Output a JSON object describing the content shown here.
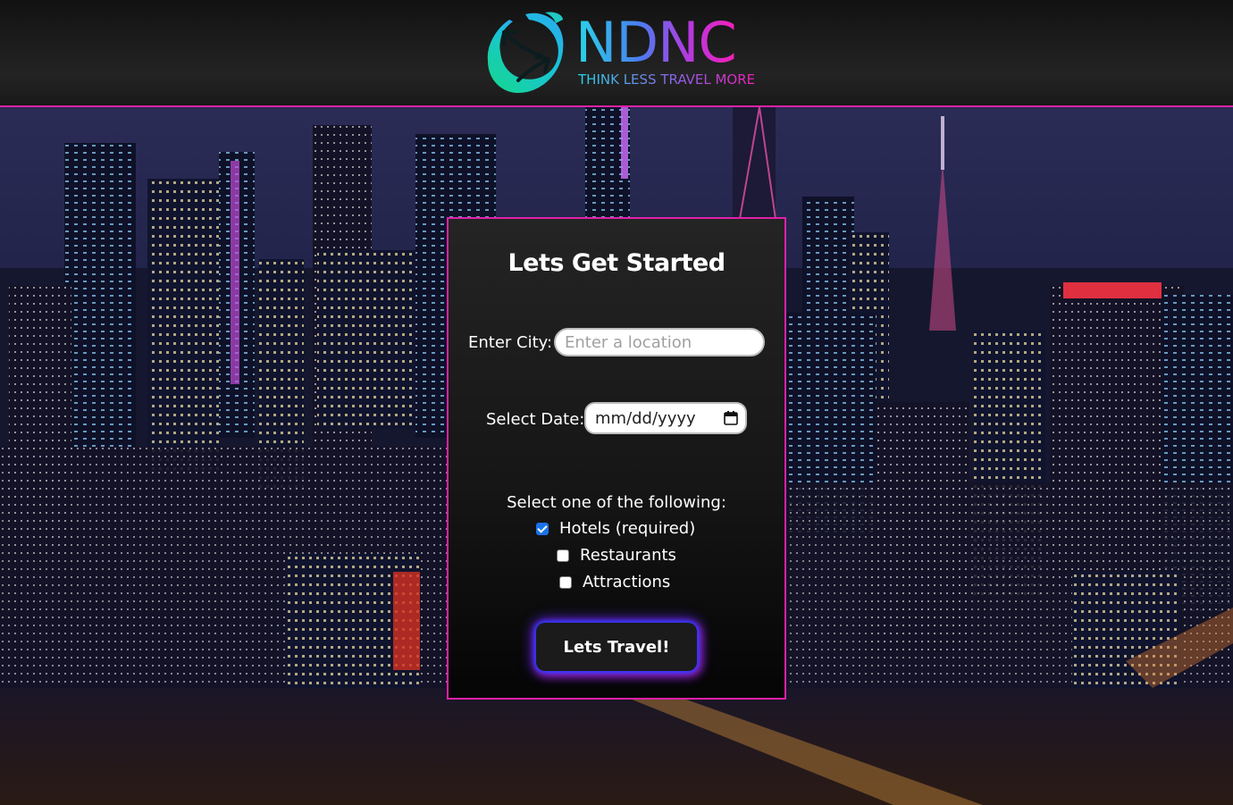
{
  "header": {
    "brand_name": "NDNC",
    "tagline": "THINK LESS TRAVEL MORE",
    "logo_icon": "globe-arrows-icon",
    "accent_color": "#e020a8"
  },
  "background": {
    "description_icon": "city-night-skyline-image"
  },
  "form": {
    "title": "Lets Get Started",
    "city_label": "Enter City:",
    "city_placeholder": "Enter a location",
    "city_value": "",
    "date_label": "Select Date:",
    "date_value": "mm/dd/yyyy",
    "options_heading": "Select one of the following:",
    "options": [
      {
        "label": "Hotels (required)",
        "checked": true
      },
      {
        "label": "Restaurants",
        "checked": false
      },
      {
        "label": "Attractions",
        "checked": false
      }
    ],
    "submit_label": "Lets Travel!"
  }
}
